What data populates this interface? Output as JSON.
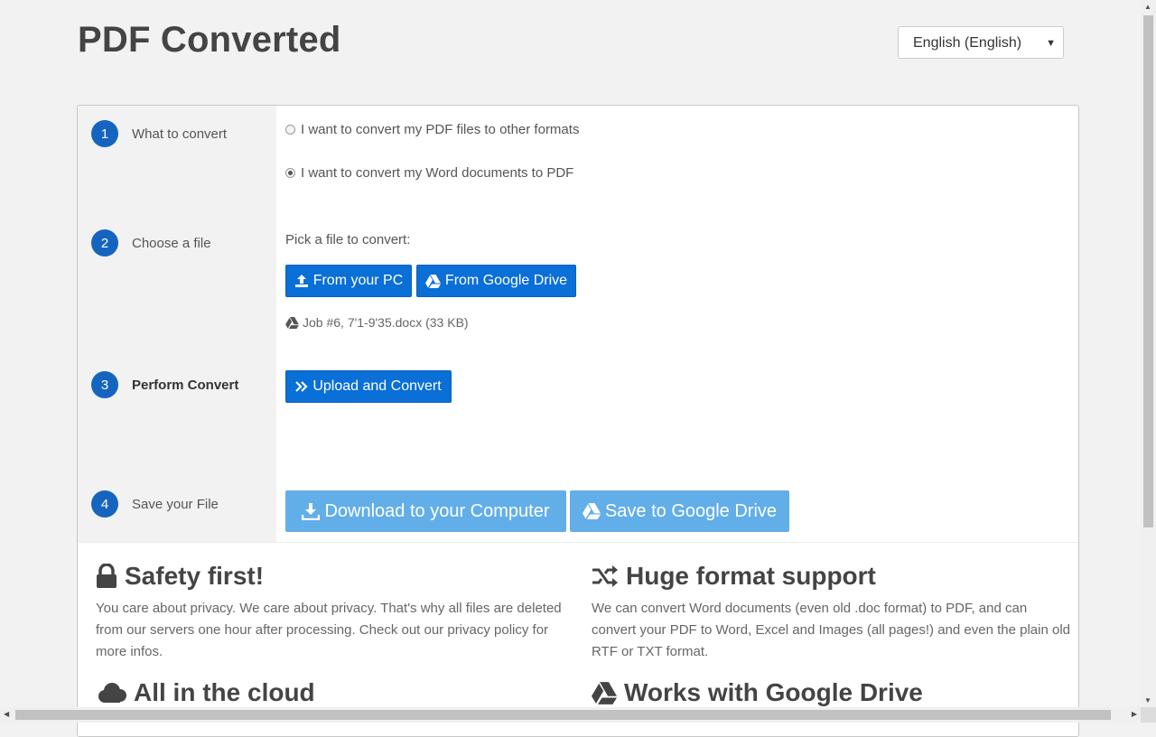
{
  "header": {
    "title": "PDF Converted"
  },
  "language": {
    "selected": "English (English)"
  },
  "steps": [
    {
      "number": "1",
      "label": "What to convert"
    },
    {
      "number": "2",
      "label": "Choose a file"
    },
    {
      "number": "3",
      "label": "Perform Convert"
    },
    {
      "number": "4",
      "label": "Save your File"
    }
  ],
  "convert_options": [
    {
      "label": "I want to convert my PDF files to other formats",
      "checked": false
    },
    {
      "label": "I want to convert my Word documents to PDF",
      "checked": true
    }
  ],
  "choose_file": {
    "prompt": "Pick a file to convert:",
    "from_pc": "From your PC",
    "from_drive": "From Google Drive",
    "selected_file": "Job #6, 7'1-9'35.docx (33 KB)"
  },
  "perform": {
    "button": "Upload and Convert"
  },
  "save": {
    "download": "Download to your Computer",
    "drive": "Save to Google Drive"
  },
  "features": [
    {
      "icon": "lock-icon",
      "title": "Safety first!",
      "text": "You care about privacy. We care about privacy. That's why all files are deleted from our servers one hour after processing. Check out our privacy policy for more infos."
    },
    {
      "icon": "shuffle-icon",
      "title": "Huge format support",
      "text": "We can convert Word documents (even old .doc format) to PDF, and can convert your PDF to Word, Excel and Images (all pages!) and even the plain old RTF or TXT format."
    },
    {
      "icon": "cloud-icon",
      "title": "All in the cloud",
      "text": ""
    },
    {
      "icon": "google-drive-icon",
      "title": "Works with Google Drive",
      "text": ""
    }
  ],
  "colors": {
    "primary": "#0a6fd6",
    "primary_disabled": "#62aee8",
    "step_circle": "#1565c0"
  }
}
